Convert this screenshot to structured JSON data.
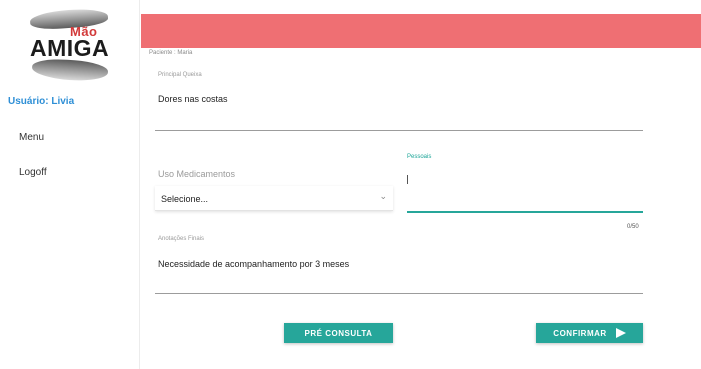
{
  "logo": {
    "top_text": "Mão",
    "main_text": "AMIGA"
  },
  "sidebar": {
    "user_label": "Usuário:",
    "user_name": "Livia",
    "items": [
      {
        "label": "Menu"
      },
      {
        "label": "Logoff"
      }
    ]
  },
  "colors": {
    "header": "#ef6f73",
    "accent": "#26a69a",
    "user_link": "#2e8fd6",
    "logo_red": "#d23a3a"
  },
  "patient": {
    "text": "Paciente : Maria"
  },
  "form": {
    "queixa": {
      "label": "Principal Queixa",
      "value": "Dores nas costas"
    },
    "medicamentos": {
      "label": "Uso Medicamentos",
      "selected": "Selecione..."
    },
    "pessoais": {
      "label": "Pessoais",
      "value": "",
      "counter": "0/50"
    },
    "anotacoes": {
      "label": "Anotações Finais",
      "value": "Necessidade de acompanhamento por 3 meses"
    }
  },
  "buttons": {
    "pre_consulta": "PRÉ CONSULTA",
    "confirmar": "CONFIRMAR"
  }
}
